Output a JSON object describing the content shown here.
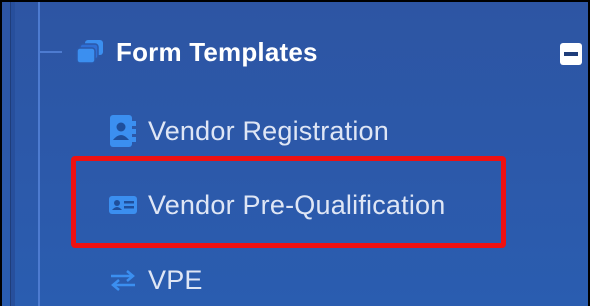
{
  "tree": {
    "parent": {
      "label": "Form Templates",
      "icon": "stack-icon",
      "expanded": true
    },
    "children": [
      {
        "label": "Vendor Registration",
        "icon": "contact-book-icon"
      },
      {
        "label": "Vendor Pre-Qualification",
        "icon": "id-card-icon",
        "highlighted": true
      },
      {
        "label": "VPE",
        "icon": "exchange-arrows-icon"
      }
    ]
  },
  "colors": {
    "background": "#2c59aa",
    "icon_blue": "#3b8ff0",
    "highlight": "#ee1111"
  }
}
